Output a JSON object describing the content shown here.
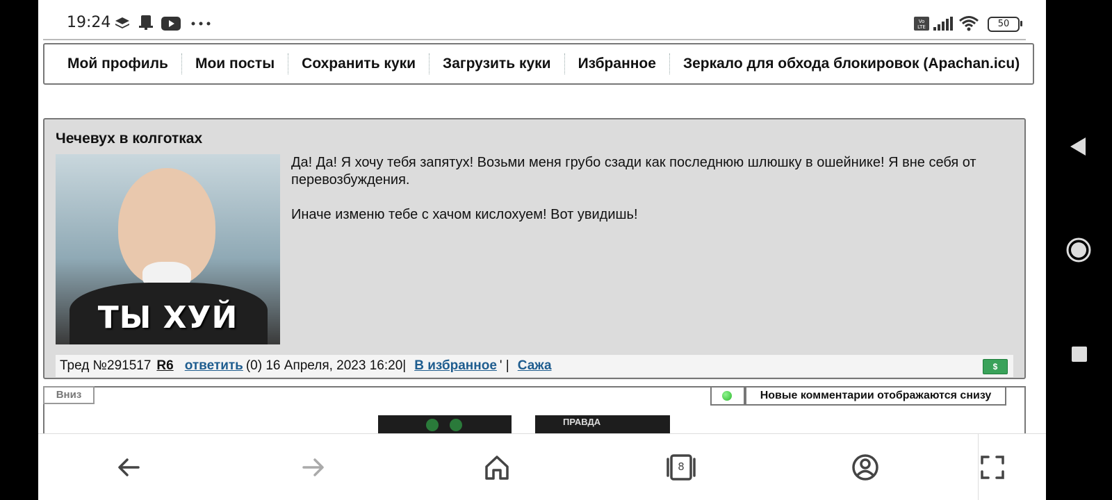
{
  "status_bar": {
    "time": "19:24",
    "battery": "50",
    "icons": [
      "layers-icon",
      "notification-icon",
      "youtube-icon",
      "more-dots-icon",
      "volte-icon",
      "signal-icon",
      "wifi-icon",
      "battery-icon"
    ]
  },
  "menu": {
    "items": [
      "Мой профиль",
      "Мои посты",
      "Сохранить куки",
      "Загрузить куки",
      "Избранное",
      "Зеркало для обхода блокировок (Apachan.icu)"
    ]
  },
  "post": {
    "title": "Чечевух в колготках",
    "image_caption": "ТЫ ХУЙ",
    "paragraphs": [
      "Да! Да! Я хочу тебя запятух! Возьми меня грубо сзади как последнюю шлюшку в ошейнике! Я вне себя от перевозбуждения.",
      "Иначе изменю тебе с хачом кислохуем! Вот увидишь!"
    ],
    "footer": {
      "thread": "Тред №291517",
      "r6": "R6",
      "reply": "ответить",
      "reply_count": "(0) 16 Апреля, 2023 16:20|",
      "favorite": "В избранное",
      "separator": "' |",
      "sage": "Сажа",
      "money": "$"
    }
  },
  "bottom_panel": {
    "down_button": "Вниз",
    "new_comments": "Новые комментарии отображаются снизу",
    "status_color": "#2eb82e",
    "thumb_label": "ПРАВДА"
  },
  "navbar": {
    "tabs_count": "8",
    "icons": [
      "back-arrow-icon",
      "forward-arrow-icon",
      "home-icon",
      "tabs-icon",
      "profile-icon",
      "fullscreen-icon"
    ]
  },
  "system_nav": {
    "icons": [
      "back-triangle-icon",
      "home-circle-icon",
      "recents-square-icon"
    ]
  }
}
